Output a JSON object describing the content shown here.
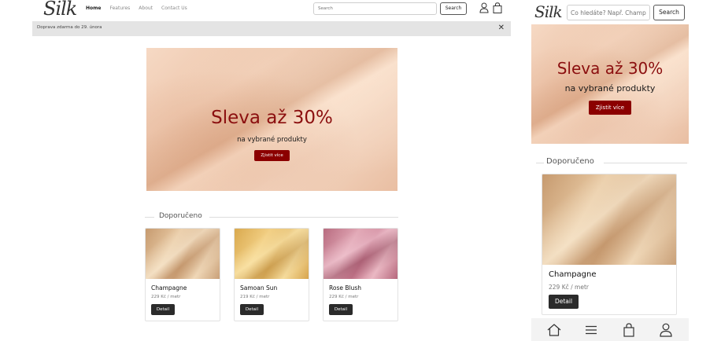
{
  "brand": {
    "logo": "Silk"
  },
  "nav": {
    "links": [
      {
        "label": "Home",
        "active": true
      },
      {
        "label": "Features",
        "active": false
      },
      {
        "label": "About",
        "active": false
      },
      {
        "label": "Contact Us",
        "active": false
      }
    ],
    "search_placeholder": "Search",
    "search_button": "Search",
    "icons": [
      "user-icon",
      "shopping-bag-icon"
    ]
  },
  "banner": {
    "text": "Doprava zdarma do 29. února",
    "close_icon": "close-icon"
  },
  "hero": {
    "title": "Sleva až 30%",
    "subtitle": "na vybrané produkty",
    "cta": "Zjistit více",
    "accent_color": "#8b0000"
  },
  "featured": {
    "title": "Doporučeno",
    "products": [
      {
        "name": "Champagne",
        "price": "229 Kč / metr",
        "button": "Detail"
      },
      {
        "name": "Samoan Sun",
        "price": "219 Kč / metr",
        "button": "Detail"
      },
      {
        "name": "Rose Blush",
        "price": "229 Kč / metr",
        "button": "Detail"
      }
    ]
  },
  "mobile": {
    "search_placeholder": "Co hledáte? Např. Champagne",
    "search_button": "Search",
    "tabbar_icons": [
      "home-icon",
      "menu-icon",
      "shopping-bag-icon",
      "user-icon"
    ]
  }
}
